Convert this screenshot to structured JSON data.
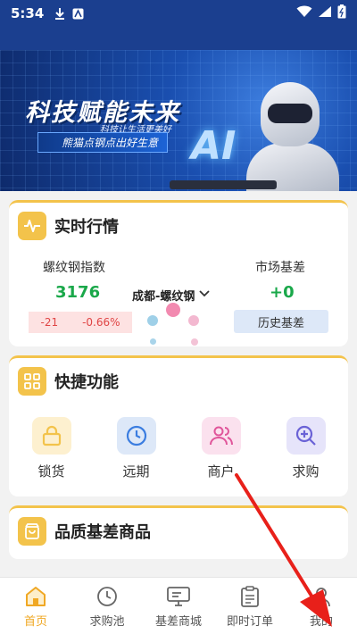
{
  "status_bar": {
    "time": "5:34"
  },
  "banner": {
    "title": "科技赋能未来",
    "subtitle": "科技让生活更美好",
    "tagline": "熊猫点钢点出好生意",
    "ai_text": "AI"
  },
  "market": {
    "title": "实时行情",
    "index_label": "螺纹钢指数",
    "index_value": "3176",
    "change_abs": "-21",
    "change_pct": "-0.66%",
    "city_select": "成都-螺纹钢",
    "basis_label": "市场基差",
    "basis_value": "+0",
    "history_button": "历史基差"
  },
  "quick": {
    "title": "快捷功能",
    "items": [
      {
        "label": "锁货",
        "icon": "lock-icon",
        "color": "#f3c34b",
        "bg": "#fdf0cf"
      },
      {
        "label": "远期",
        "icon": "clock-icon",
        "color": "#3b7de0",
        "bg": "#dde8f8"
      },
      {
        "label": "商户",
        "icon": "users-icon",
        "color": "#e0559a",
        "bg": "#fbe1ee"
      },
      {
        "label": "求购",
        "icon": "search-plus-icon",
        "color": "#6a62d6",
        "bg": "#e6e4fa"
      }
    ]
  },
  "quality": {
    "title": "品质基差商品"
  },
  "tabbar": {
    "items": [
      {
        "label": "首页",
        "icon": "home-icon",
        "active": true
      },
      {
        "label": "求购池",
        "icon": "clock-icon",
        "active": false
      },
      {
        "label": "基差商城",
        "icon": "monitor-icon",
        "active": false
      },
      {
        "label": "即时订单",
        "icon": "clipboard-icon",
        "active": false
      },
      {
        "label": "我的",
        "icon": "user-icon",
        "active": false
      }
    ]
  },
  "colors": {
    "accent": "#f3c34b",
    "up_green": "#1aa84a",
    "down_red": "#e04545",
    "tab_active": "#f0a824",
    "header_blue": "#1b3f8f"
  }
}
